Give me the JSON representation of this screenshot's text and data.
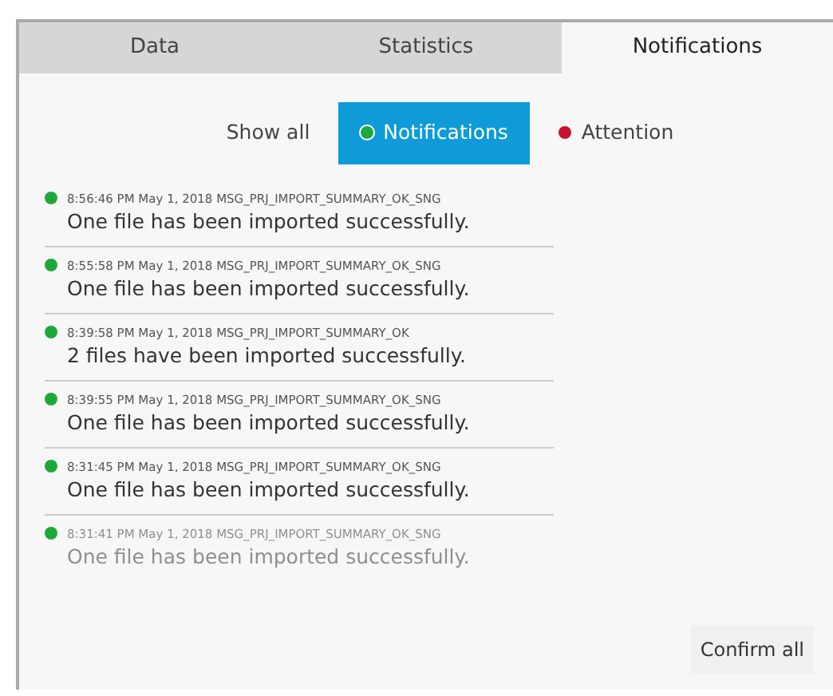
{
  "tabs": [
    {
      "label": "Data",
      "selected": false
    },
    {
      "label": "Statistics",
      "selected": false
    },
    {
      "label": "Notifications",
      "selected": true
    }
  ],
  "filters": [
    {
      "label": "Show all",
      "selected": false
    },
    {
      "label": "Notifications",
      "selected": true,
      "color": "#1fa83a"
    },
    {
      "label": "Attention",
      "selected": false,
      "color": "#c8102e"
    }
  ],
  "messages": [
    {
      "meta": "8:56:46 PM May 1, 2018 MSG_PRJ_IMPORT_SUMMARY_OK_SNG",
      "text": "One file has been imported successfully.",
      "color": "#1fa83a",
      "faded": false
    },
    {
      "meta": "8:55:58 PM May 1, 2018 MSG_PRJ_IMPORT_SUMMARY_OK_SNG",
      "text": "One file has been imported successfully.",
      "color": "#1fa83a",
      "faded": false
    },
    {
      "meta": "8:39:58 PM May 1, 2018 MSG_PRJ_IMPORT_SUMMARY_OK",
      "text": "2 files have been imported successfully.",
      "color": "#1fa83a",
      "faded": false
    },
    {
      "meta": "8:39:55 PM May 1, 2018 MSG_PRJ_IMPORT_SUMMARY_OK_SNG",
      "text": "One file has been imported successfully.",
      "color": "#1fa83a",
      "faded": false
    },
    {
      "meta": "8:31:45 PM May 1, 2018 MSG_PRJ_IMPORT_SUMMARY_OK_SNG",
      "text": "One file has been imported successfully.",
      "color": "#1fa83a",
      "faded": false
    },
    {
      "meta": "8:31:41 PM May 1, 2018 MSG_PRJ_IMPORT_SUMMARY_OK_SNG",
      "text": "One file has been imported successfully.",
      "color": "#1fa83a",
      "faded": true
    }
  ],
  "confirm_button": "Confirm all"
}
